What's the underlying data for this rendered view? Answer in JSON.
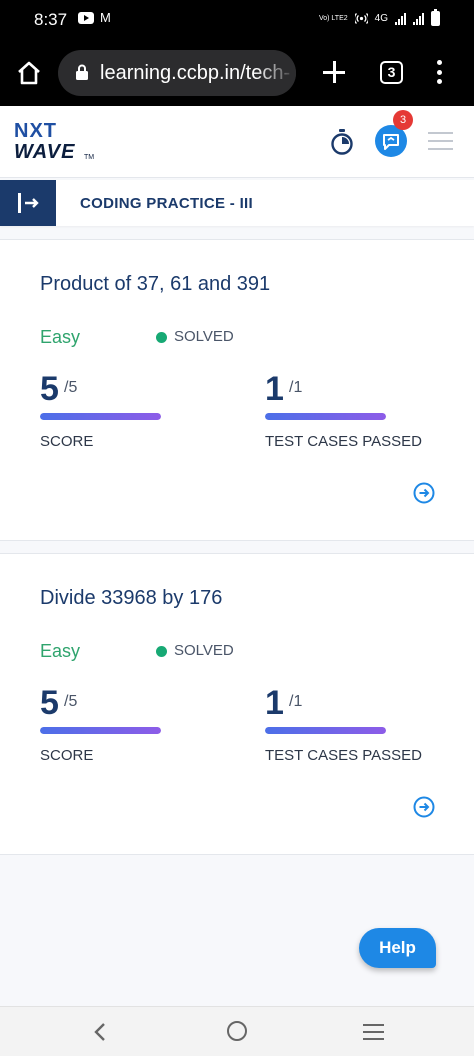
{
  "status_bar": {
    "time": "8:37",
    "network_type": "4G",
    "volte_label": "Vo) LTE2"
  },
  "browser": {
    "url": "learning.ccbp.in/tech-",
    "tab_count": "3"
  },
  "app_header": {
    "logo_top": "NXT",
    "logo_bottom": "WAVE",
    "logo_tm": "TM",
    "notification_count": "3"
  },
  "section": {
    "title": "CODING PRACTICE - III"
  },
  "problems": [
    {
      "title": "Product of 37, 61 and 391",
      "difficulty": "Easy",
      "status": "SOLVED",
      "score_value": "5",
      "score_total": "/5",
      "score_fraction": 1.0,
      "score_label": "SCORE",
      "tests_value": "1",
      "tests_total": "/1",
      "tests_fraction": 1.0,
      "tests_label": "TEST CASES PASSED"
    },
    {
      "title": "Divide 33968 by 176",
      "difficulty": "Easy",
      "status": "SOLVED",
      "score_value": "5",
      "score_total": "/5",
      "score_fraction": 1.0,
      "score_label": "SCORE",
      "tests_value": "1",
      "tests_total": "/1",
      "tests_fraction": 1.0,
      "tests_label": "TEST CASES PASSED"
    }
  ],
  "help": {
    "label": "Help"
  },
  "colors": {
    "brand_navy": "#1b3a6b",
    "accent_blue": "#1e88e5",
    "easy_green": "#2fa46d",
    "solved_green": "#17a974",
    "badge_red": "#e53935"
  }
}
